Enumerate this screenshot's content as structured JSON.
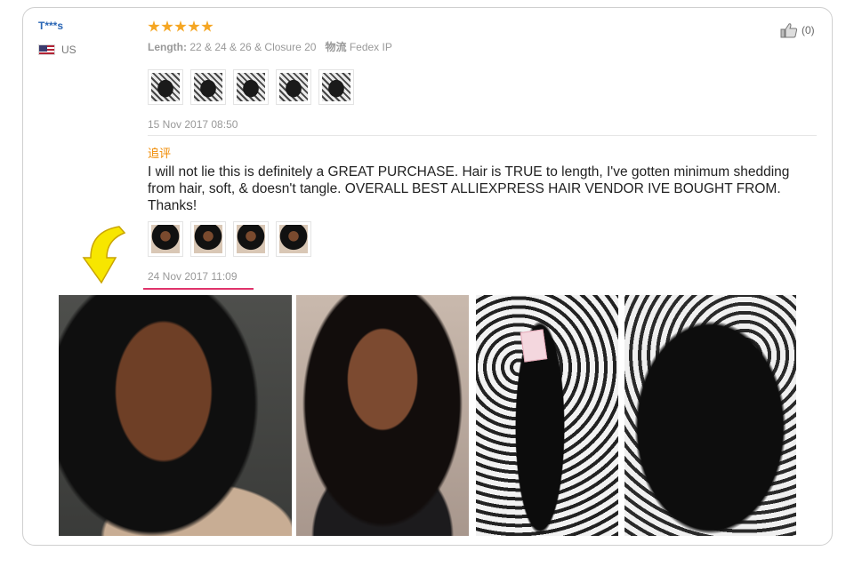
{
  "review": {
    "user": "T***s",
    "country": "US",
    "rating": 5,
    "product_key": "Length:",
    "product_value": "22 & 24 & 26 & Closure 20",
    "shipping_key": "物流",
    "shipping_value": "Fedex IP",
    "helpful_count": "(0)",
    "timestamp": "15 Nov 2017 08:50"
  },
  "additional_feedback": {
    "label": "追评",
    "text": "I will not lie this is definitely a GREAT PURCHASE. Hair is TRUE to length, I've gotten minimum shedding from hair, soft, & doesn't tangle. OVERALL BEST ALLIEXPRESS HAIR VENDOR IVE BOUGHT FROM. Thanks!",
    "timestamp": "24 Nov 2017 11:09"
  },
  "colors": {
    "username": "#2a66b5",
    "stars": "#f5a623",
    "additional_label": "#f08a00",
    "highlight_underline": "#e0336b",
    "arrow": "#f7e600"
  },
  "icons": [
    "us-flag-icon",
    "star-icon",
    "thumbs-up-icon",
    "arrow-icon"
  ]
}
